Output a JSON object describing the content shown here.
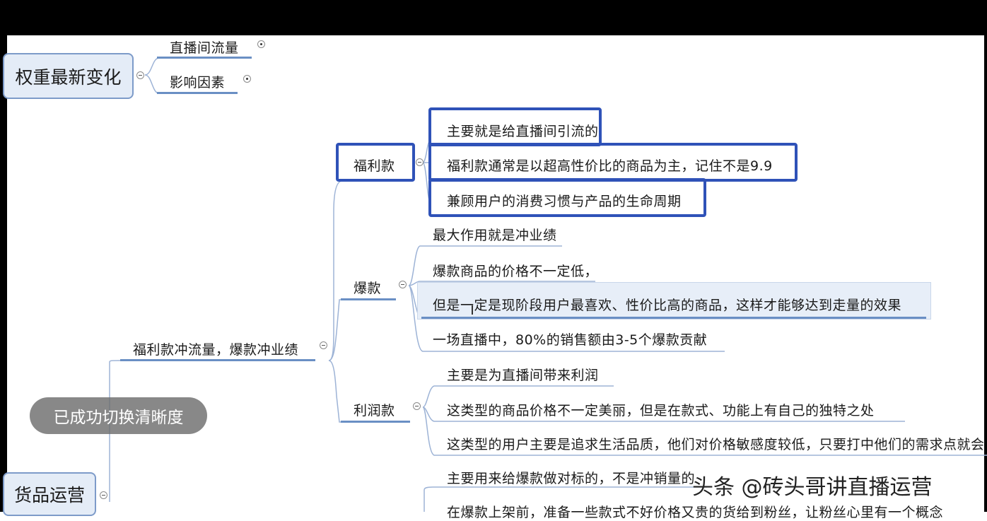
{
  "roots": {
    "top": "权重最新变化",
    "bottom": "货品运营"
  },
  "top_children": {
    "traffic": "直播间流量",
    "factors": "影响因素"
  },
  "branch": "福利款冲流量，爆款冲业绩",
  "categories": {
    "welfare": "福利款",
    "hot": "爆款",
    "profit": "利润款"
  },
  "welfare_items": [
    "主要就是给直播间引流的",
    "福利款通常是以超高性价比的商品为主，记住不是9.9",
    "兼顾用户的消费习惯与产品的生命周期"
  ],
  "hot_items": [
    "最大作用就是冲业绩",
    "爆款商品的价格不一定低，",
    "但是一定是现阶段用户最喜欢、性价比高的商品，这样才能够达到走量的效果",
    "一场直播中，80%的销售额由3-5个爆款贡献"
  ],
  "profit_items": [
    "主要是为直播间带来利润",
    "这类型的商品价格不一定美丽，但是在款式、功能上有自己的独特之处",
    "这类型的用户主要是追求生活品质，他们对价格敏感度较低，只要打中他们的需求点就会"
  ],
  "bottom_items": [
    "主要用来给爆款做对标的，不是冲销量的",
    "在爆款上架前，准备一些款式不好价格又贵的货给到粉丝，让粉丝心里有一个概念"
  ],
  "toast": "已成功切换清晰度",
  "watermark": "头条 @砖头哥讲直播运营",
  "colors": {
    "highlight_border": "#2f52b8",
    "underline": "#6a8fc4",
    "root_fill": "#e4ecf7",
    "connector": "#9db3d6"
  }
}
